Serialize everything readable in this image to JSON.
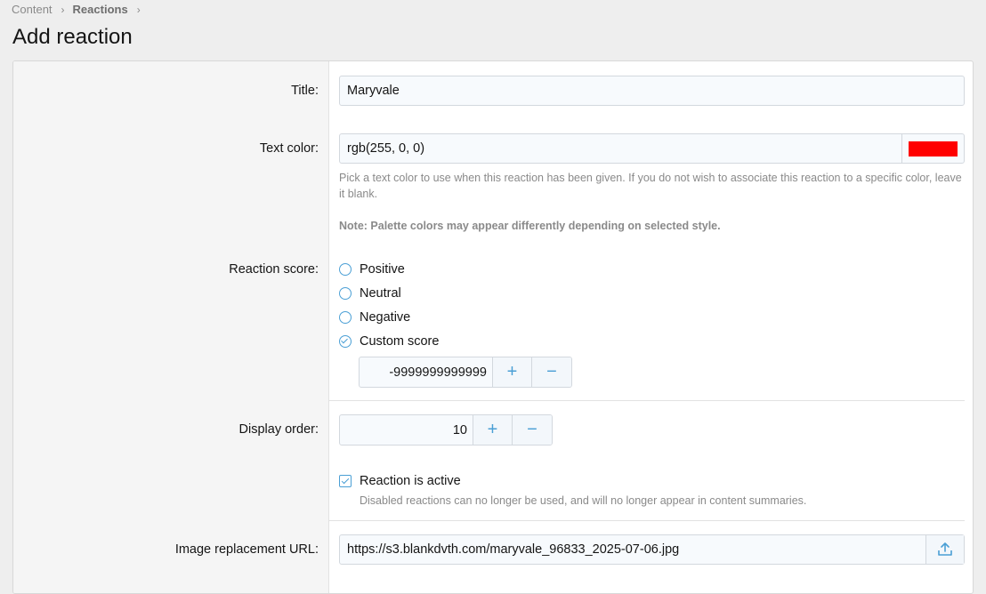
{
  "breadcrumb": {
    "items": [
      "Content",
      "Reactions"
    ]
  },
  "page": {
    "title": "Add reaction"
  },
  "form": {
    "title": {
      "label": "Title:",
      "value": "Maryvale"
    },
    "text_color": {
      "label": "Text color:",
      "value": "rgb(255, 0, 0)",
      "swatch": "#ff0000",
      "hint": "Pick a text color to use when this reaction has been given. If you do not wish to associate this reaction to a specific color, leave it blank.",
      "note": "Note: Palette colors may appear differently depending on selected style."
    },
    "reaction_score": {
      "label": "Reaction score:",
      "options": [
        "Positive",
        "Neutral",
        "Negative",
        "Custom score"
      ],
      "selected": "Custom score",
      "custom_value": "-9999999999999"
    },
    "display_order": {
      "label": "Display order:",
      "value": "10"
    },
    "active": {
      "label": "Reaction is active",
      "checked": true,
      "hint": "Disabled reactions can no longer be used, and will no longer appear in content summaries."
    },
    "image_url": {
      "label": "Image replacement URL:",
      "value": "https://s3.blankdvth.com/maryvale_96833_2025-07-06.jpg"
    },
    "icons": {
      "plus": "+",
      "minus": "−",
      "chevron": "›"
    }
  },
  "colors": {
    "accent": "#4a9fd5",
    "swatch": "#ff0000"
  }
}
